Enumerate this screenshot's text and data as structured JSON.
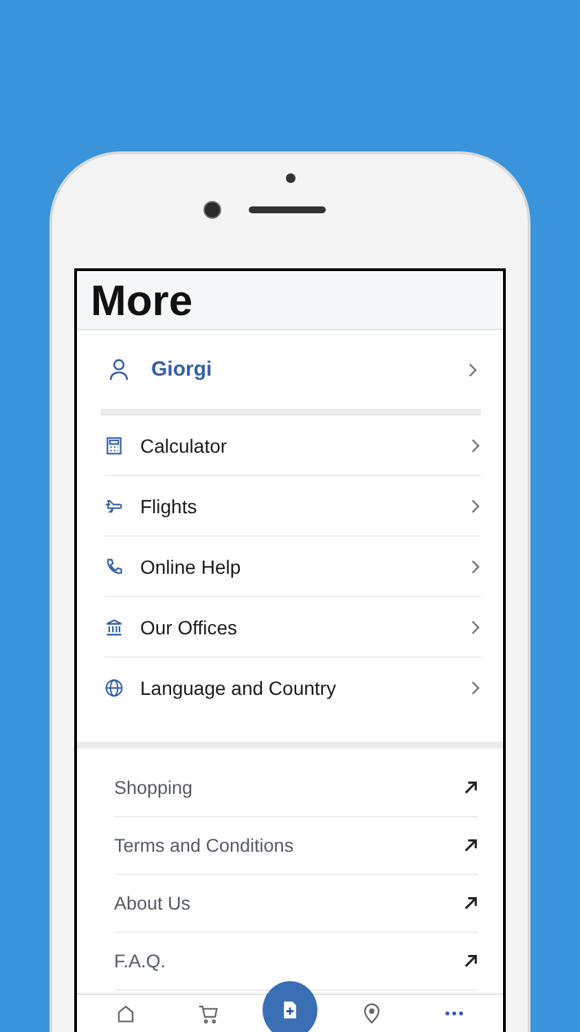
{
  "header": {
    "title": "More"
  },
  "profile": {
    "name": "Giorgi"
  },
  "menu": [
    {
      "label": "Calculator"
    },
    {
      "label": "Flights"
    },
    {
      "label": "Online Help"
    },
    {
      "label": "Our Offices"
    },
    {
      "label": "Language and Country"
    }
  ],
  "links": [
    {
      "label": "Shopping"
    },
    {
      "label": "Terms and Conditions"
    },
    {
      "label": "About Us"
    },
    {
      "label": "F.A.Q."
    }
  ],
  "bottom_nav": [
    {
      "kind": "home",
      "selected": false
    },
    {
      "kind": "cart",
      "selected": false
    },
    {
      "kind": "add",
      "selected": false
    },
    {
      "kind": "location",
      "selected": false
    },
    {
      "kind": "more",
      "selected": true
    }
  ]
}
